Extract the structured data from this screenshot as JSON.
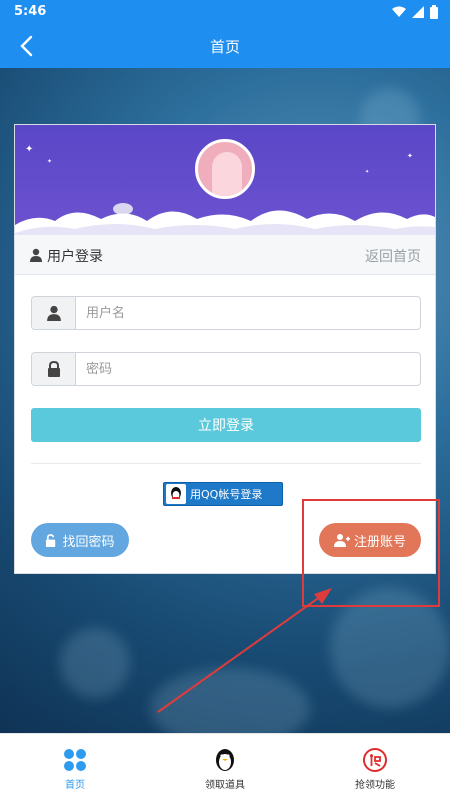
{
  "status_bar": {
    "time": "5:46"
  },
  "app_bar": {
    "title": "首页"
  },
  "login_panel": {
    "header_title": "用户登录",
    "back_home_link": "返回首页",
    "username": {
      "placeholder": "用户名",
      "value": ""
    },
    "password": {
      "placeholder": "密码",
      "value": ""
    },
    "login_button": "立即登录",
    "qq_login_button": "用QQ帐号登录",
    "find_password_button": "找回密码",
    "register_button": "注册账号"
  },
  "bottom_nav": {
    "items": [
      {
        "label": "首页",
        "icon": "home-grid-icon",
        "active": true
      },
      {
        "label": "领取道具",
        "icon": "penguin-icon",
        "active": false
      },
      {
        "label": "抢领功能",
        "icon": "grab-icon",
        "active": false
      }
    ]
  },
  "colors": {
    "app_bar": "#1f8ef1",
    "login_button": "#5bc9dc",
    "find_password_button": "#62a7df",
    "register_button": "#e17659",
    "banner": "#5a47c7",
    "annotation": "#e03b3b"
  }
}
